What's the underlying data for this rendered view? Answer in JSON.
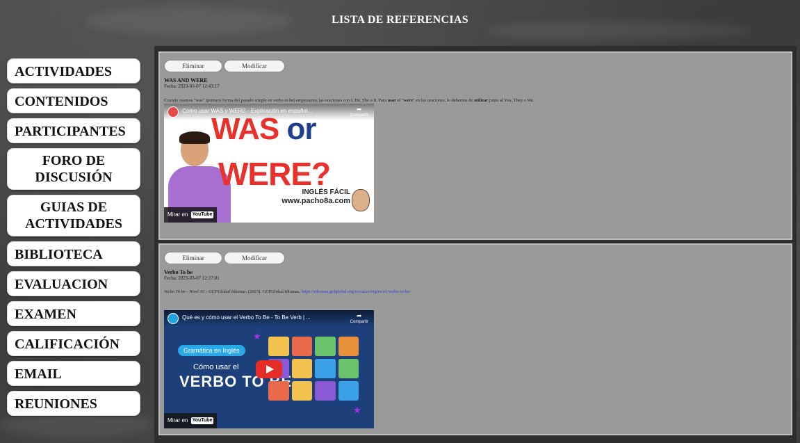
{
  "page": {
    "title": "LISTA DE REFERENCIAS"
  },
  "sidebar": {
    "items": [
      {
        "label": "ACTIVIDADES"
      },
      {
        "label": "CONTENIDOS"
      },
      {
        "label": "PARTICIPANTES"
      },
      {
        "label": "FORO DE DISCUSIÓN"
      },
      {
        "label": "GUIAS DE ACTIVIDADES"
      },
      {
        "label": "BIBLIOTECA"
      },
      {
        "label": "EVALUACION"
      },
      {
        "label": "EXAMEN"
      },
      {
        "label": "CALIFICACIÓN"
      },
      {
        "label": "EMAIL"
      },
      {
        "label": "REUNIONES"
      }
    ]
  },
  "references": [
    {
      "delete_label": "Eliminar",
      "edit_label": "Modificar",
      "title": "WAS AND WERE",
      "date": "Fecha: 2023-03-07 12:43:17",
      "desc_a": "Cuando usamos \"was\" (primera forma del pasado simple en verbo to be) empezamos las oraciones con I, He, She o It. Para ",
      "desc_b": "usar",
      "desc_c": " el \"",
      "desc_d": "were",
      "desc_e": "\" en las oraciones, lo debemos de ",
      "desc_f": "utilizar",
      "desc_g": " junto al You, They o We.",
      "video": {
        "title": "Como usar WAS y WERE - Explicación en español...",
        "share_label": "Compartir",
        "watch_on": "Mirar en",
        "yt_label": "YouTube",
        "thumb_line1": "WAS ",
        "thumb_line1_or": "or",
        "thumb_line2": "WERE?",
        "thumb_brand": "INGLÉS FÁCIL",
        "thumb_site": "www.pacho8a.com"
      }
    },
    {
      "delete_label": "Eliminar",
      "edit_label": "Modificar",
      "title": "Verbo To be",
      "date": "Fecha: 2023-03-07 12:37:01",
      "citation_title": "Verbo To be - Nivel A1 - GCFGlobal Idiomas.",
      "citation_rest": " (2023). GCFGlobal Idiomas. ",
      "citation_url": "https://idiomas.gcfglobal.org/es/curso/ingles/a1/verbo-to-be/",
      "video": {
        "title": "Qué es y cómo usar el Verbo To Be - To Be Verb | ...",
        "share_label": "Compartir",
        "watch_on": "Mirar en",
        "yt_label": "YouTube",
        "thumb_pill": "Gramática en Inglés",
        "thumb_como": "Cómo usar el",
        "thumb_verbo": "VERBO TO BE"
      }
    }
  ],
  "colors": {
    "link": "#2a3fd6",
    "thumb_red": "#e8312b",
    "thumb_blue": "#1d3f7a"
  },
  "icons": [
    "share-icon",
    "youtube-play-icon",
    "channel-avatar-icon"
  ]
}
